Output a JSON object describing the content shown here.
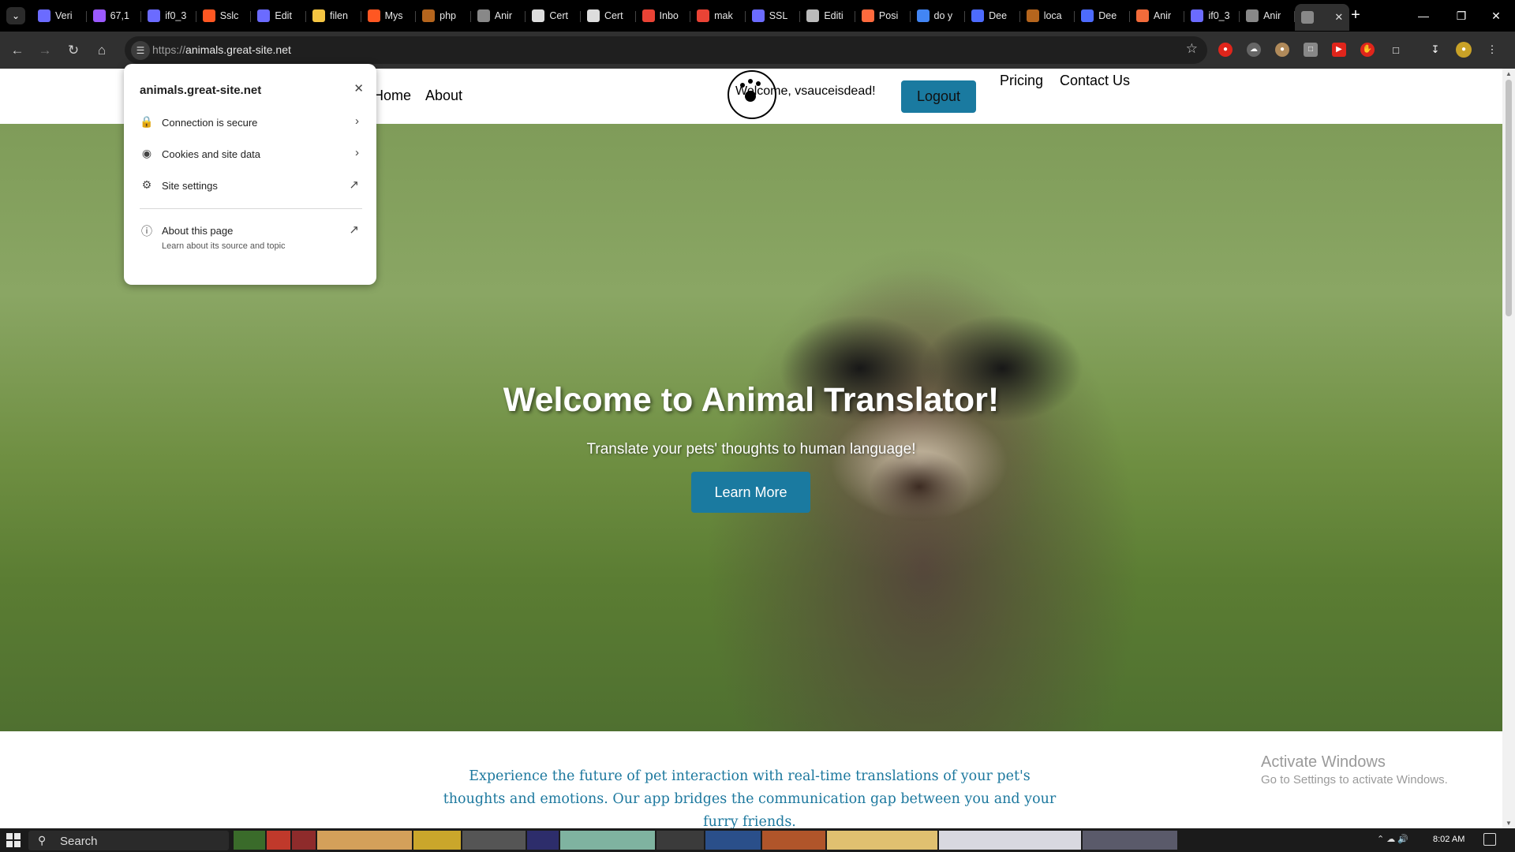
{
  "browser": {
    "tabs": [
      {
        "title": "Veri",
        "icon": "infinity-icon",
        "color": "#6b6bff"
      },
      {
        "title": "67,1",
        "icon": "mail-icon",
        "color": "#9b59ff"
      },
      {
        "title": "if0_3",
        "icon": "infinity-icon",
        "color": "#6b6bff"
      },
      {
        "title": "Sslc",
        "icon": "link-icon",
        "color": "#ff5722"
      },
      {
        "title": "Edit",
        "icon": "infinity-icon",
        "color": "#6b6bff"
      },
      {
        "title": "filen",
        "icon": "clock-icon",
        "color": "#f5c542"
      },
      {
        "title": "Mys",
        "icon": "link-icon",
        "color": "#ff5722"
      },
      {
        "title": "php",
        "icon": "triangle-icon",
        "color": "#b5651d"
      },
      {
        "title": "Anir",
        "icon": "globe-icon",
        "color": "#888888"
      },
      {
        "title": "Cert",
        "icon": "person-icon",
        "color": "#dddddd"
      },
      {
        "title": "Cert",
        "icon": "person-icon",
        "color": "#dddddd"
      },
      {
        "title": "Inbo",
        "icon": "gmail-icon",
        "color": "#ea4335"
      },
      {
        "title": "mak",
        "icon": "gmail-icon",
        "color": "#ea4335"
      },
      {
        "title": "SSL",
        "icon": "infinity-icon",
        "color": "#6b6bff"
      },
      {
        "title": "Editi",
        "icon": "github-icon",
        "color": "#bbbbbb"
      },
      {
        "title": "Posi",
        "icon": "spark-icon",
        "color": "#ff6a3d"
      },
      {
        "title": "do y",
        "icon": "google-icon",
        "color": "#4285f4"
      },
      {
        "title": "Dee",
        "icon": "deepl-icon",
        "color": "#4d6bfe"
      },
      {
        "title": "loca",
        "icon": "triangle-icon",
        "color": "#b5651d"
      },
      {
        "title": "Dee",
        "icon": "deepl-icon",
        "color": "#4d6bfe"
      },
      {
        "title": "Anir",
        "icon": "box-icon",
        "color": "#f26b3a"
      },
      {
        "title": "if0_3",
        "icon": "infinity-icon",
        "color": "#6b6bff"
      },
      {
        "title": "Anir",
        "icon": "globe-icon",
        "color": "#888888"
      },
      {
        "title": "",
        "icon": "globe-icon",
        "color": "#888888",
        "active": true
      }
    ],
    "url_scheme": "https://",
    "url_host": "animals.great-site.net"
  },
  "popup": {
    "domain": "animals.great-site.net",
    "connection": "Connection is secure",
    "cookies": "Cookies and site data",
    "site_settings": "Site settings",
    "about_title": "About this page",
    "about_sub": "Learn about its source and topic"
  },
  "site": {
    "nav": {
      "home": "Home",
      "about": "About",
      "pricing": "Pricing",
      "contact": "Contact Us"
    },
    "welcome": "Welcome, vsauceisdead!",
    "logout": "Logout",
    "hero_title": "Welcome to Animal Translator!",
    "hero_subtitle": "Translate your pets' thoughts to human language!",
    "learn_more": "Learn More",
    "intro": "Experience the future of pet interaction with real-time translations of your pet's thoughts and emotions. Our app bridges the communication gap between you and your furry friends.",
    "brand_color": "#1a7aa0"
  },
  "watermark": {
    "title": "Activate Windows",
    "subtitle": "Go to Settings to activate Windows."
  },
  "taskbar": {
    "search": "Search",
    "time": "8:02 AM"
  }
}
